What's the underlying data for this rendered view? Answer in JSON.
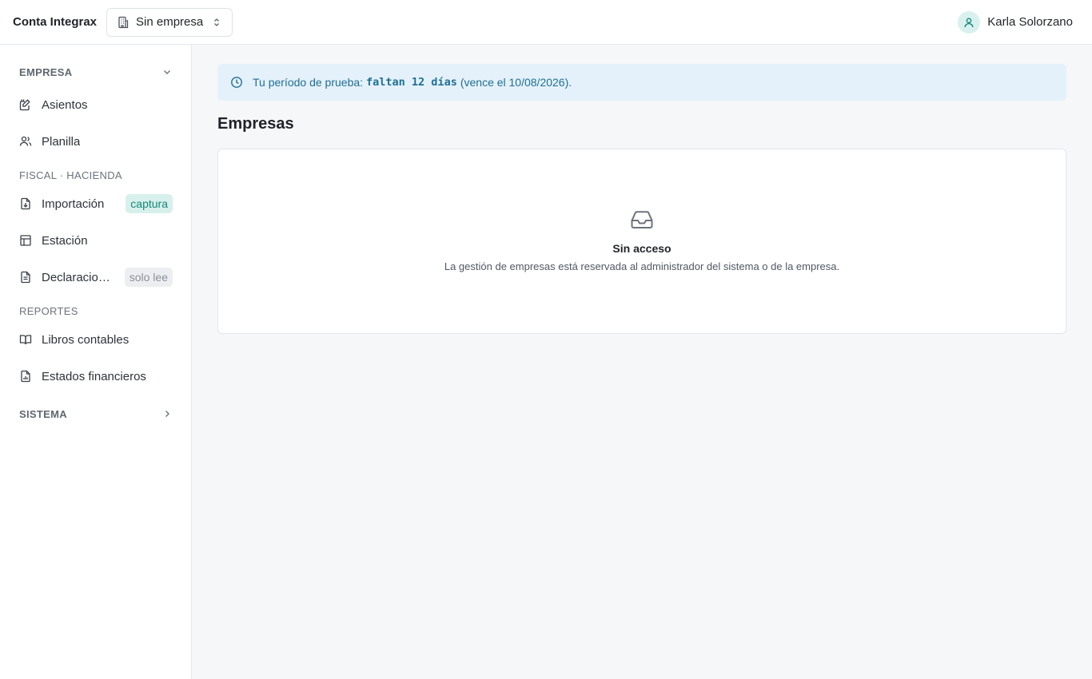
{
  "app": {
    "brand": "Conta Integrax"
  },
  "company_selector": {
    "value": "Sin empresa"
  },
  "user": {
    "name": "Karla Solorzano"
  },
  "sidebar": {
    "sections": {
      "empresa": "EMPRESA",
      "fiscal": "FISCAL · HACIENDA",
      "reportes": "REPORTES",
      "sistema": "SISTEMA"
    },
    "items": {
      "asientos": "Asientos",
      "planilla": "Planilla",
      "importacion": "Importación",
      "importacion_badge": "captura",
      "estacion": "Estación",
      "declaraciones": "Declaraciones",
      "declaraciones_badge": "solo lee",
      "libros": "Libros contables",
      "estados": "Estados financieros"
    }
  },
  "trial": {
    "prefix": "Tu período de prueba:",
    "highlight": "faltan 12 días",
    "suffix": "(vence el 10/08/2026)."
  },
  "page": {
    "title": "Empresas"
  },
  "empty_state": {
    "title": "Sin acceso",
    "description": "La gestión de empresas está reservada al administrador del sistema o de la empresa."
  },
  "colors": {
    "accent": "#16877a",
    "info_bg": "#e4f1fa",
    "info_text": "#1f6f94"
  }
}
